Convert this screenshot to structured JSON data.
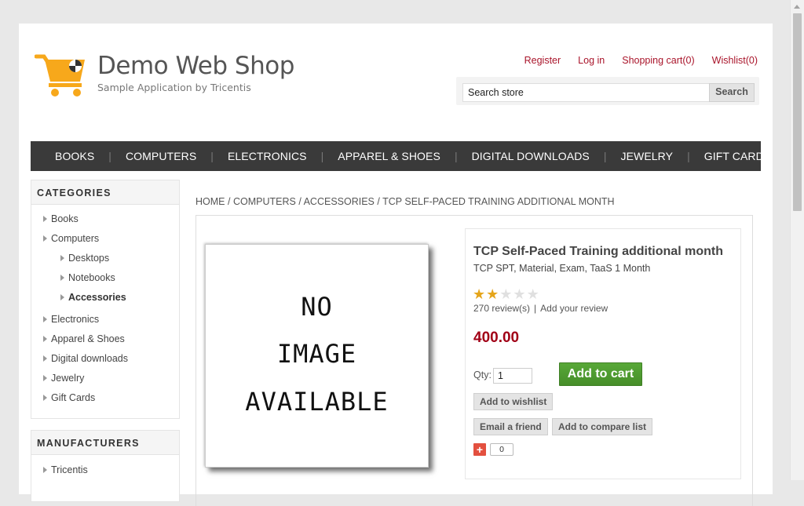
{
  "header": {
    "title": "Demo Web Shop",
    "subtitle": "Sample Application by Tricentis",
    "links": {
      "register": "Register",
      "login": "Log in",
      "cart": "Shopping cart(0)",
      "wishlist": "Wishlist(0)"
    },
    "search": {
      "value": "Search store",
      "button": "Search"
    },
    "logo_color": "#f7a81b"
  },
  "menu": [
    "BOOKS",
    "COMPUTERS",
    "ELECTRONICS",
    "APPAREL & SHOES",
    "DIGITAL DOWNLOADS",
    "JEWELRY",
    "GIFT CARDS"
  ],
  "sidebar": {
    "categories_title": "CATEGORIES",
    "categories": [
      {
        "label": "Books"
      },
      {
        "label": "Computers"
      },
      {
        "label": "Desktops"
      },
      {
        "label": "Notebooks"
      },
      {
        "label": "Accessories"
      },
      {
        "label": "Electronics"
      },
      {
        "label": "Apparel & Shoes"
      },
      {
        "label": "Digital downloads"
      },
      {
        "label": "Jewelry"
      },
      {
        "label": "Gift Cards"
      }
    ],
    "manufacturers_title": "MANUFACTURERS",
    "manufacturers": [
      {
        "label": "Tricentis"
      }
    ]
  },
  "breadcrumb": {
    "home": "HOME",
    "computers": "COMPUTERS",
    "accessories": "ACCESSORIES",
    "current": "TCP SELF-PACED TRAINING ADDITIONAL MONTH",
    "separator": "/"
  },
  "product": {
    "image_text": [
      "NO",
      "IMAGE",
      "AVAILABLE"
    ],
    "name": "TCP Self-Paced Training additional month",
    "short_description": "TCP SPT, Material, Exam, TaaS 1 Month",
    "rating": 2,
    "rating_max": 5,
    "reviews": "270 review(s)",
    "review_sep": "|",
    "add_review": "Add your review",
    "price": "400.00",
    "qty_label": "Qty:",
    "qty_value": "1",
    "add_to_cart": "Add to cart",
    "add_to_wishlist": "Add to wishlist",
    "email_friend": "Email a friend",
    "add_to_compare": "Add to compare list",
    "share_icon": "+",
    "share_count": "0",
    "price_color": "#a10016",
    "cart_button_color": "#4d9b2e"
  }
}
